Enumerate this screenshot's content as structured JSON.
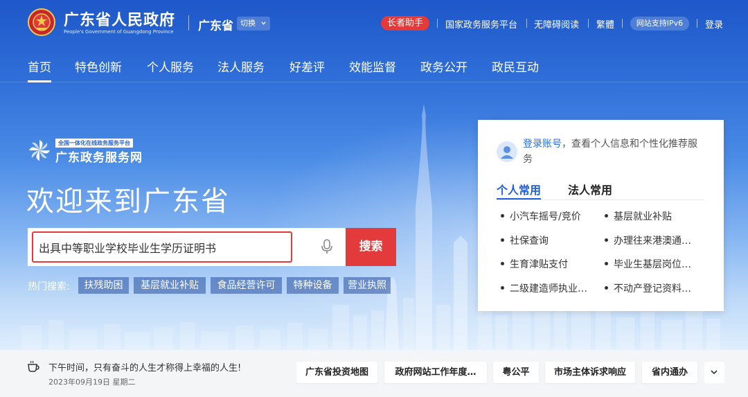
{
  "header": {
    "brand_cn": "广东省人民政府",
    "brand_en": "People's Government of Guangdong Province",
    "province": "广东省",
    "switch_label": "切换",
    "elder_assist": "长者助手",
    "links": [
      "国家政务服务平台",
      "无障碍阅读",
      "繁體"
    ],
    "ipv6": "网站支持IPv6",
    "login": "登录"
  },
  "nav": {
    "items": [
      "首页",
      "特色创新",
      "个人服务",
      "法人服务",
      "好差评",
      "效能监督",
      "政务公开",
      "政民互动"
    ],
    "active": "首页"
  },
  "platform": {
    "tag": "全国一体化在线政务服务平台",
    "name": "广东政务服务网"
  },
  "welcome": "欢迎来到广东省",
  "search": {
    "value": "出具中等职业学校毕业生学历证明书",
    "button": "搜索"
  },
  "hot": {
    "label": "热门搜索:",
    "tags": [
      "扶残助困",
      "基层就业补贴",
      "食品经营许可",
      "特种设备",
      "营业执照"
    ]
  },
  "card": {
    "login_link": "登录账号",
    "login_desc": "，查看个人信息和个性化推荐服务",
    "tabs": [
      "个人常用",
      "法人常用"
    ],
    "services": [
      "小汽车摇号/竞价",
      "基层就业补贴",
      "社保查询",
      "办理往来港澳通…",
      "生育津贴支付",
      "毕业生基层岗位…",
      "二级建造师执业…",
      "不动产登记资料…"
    ]
  },
  "bottom": {
    "greeting": "下午时间，只有奋斗的人生才称得上幸福的人生!",
    "date": "2023年09月19日 星期二",
    "links": [
      "广东省投资地图",
      "政府网站工作年度…",
      "粤公平",
      "市场主体诉求响应",
      "省内通办"
    ]
  },
  "colors": {
    "primary_blue": "#2b63d1",
    "accent_red": "#e33b3b",
    "link_blue": "#2b6fe0"
  }
}
